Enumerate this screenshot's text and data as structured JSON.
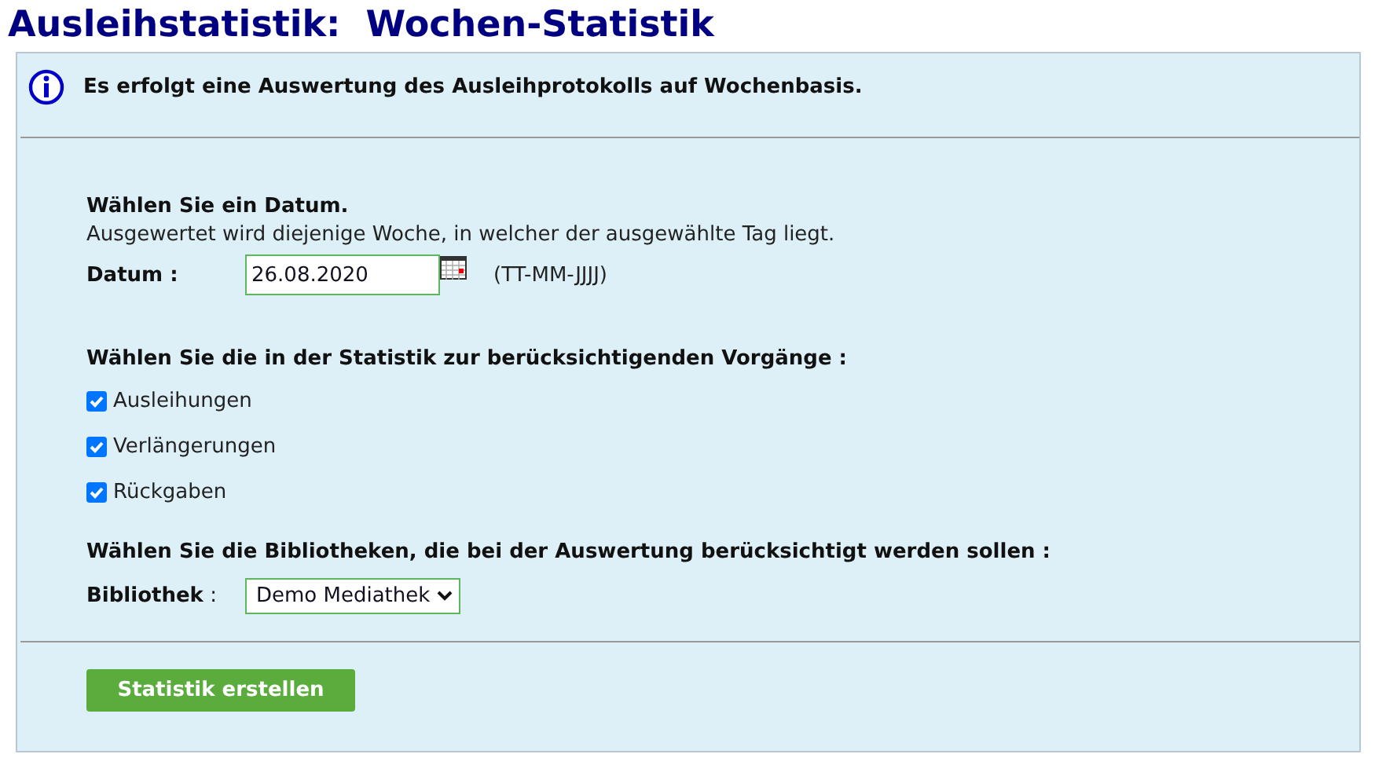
{
  "title": "Ausleihstatistik:  Wochen-Statistik",
  "info": "Es erfolgt eine Auswertung des Ausleihprotokolls auf Wochenbasis.",
  "date_section": {
    "heading": "Wählen Sie ein Datum.",
    "hint": "Ausgewertet wird diejenige Woche, in welcher der ausgewählte Tag liegt.",
    "label": "Datum :",
    "value": "26.08.2020",
    "format": "(TT-MM-JJJJ)"
  },
  "types_section": {
    "heading": "Wählen Sie die in der Statistik zur berücksichtigenden Vorgänge :",
    "options": [
      {
        "label": "Ausleihungen",
        "checked": true
      },
      {
        "label": "Verlängerungen",
        "checked": true
      },
      {
        "label": "Rückgaben",
        "checked": true
      }
    ]
  },
  "library_section": {
    "heading": "Wählen Sie die Bibliotheken, die bei der Auswertung berücksichtigt werden sollen :",
    "label": "**Bibliothek** :",
    "value": "Demo Mediathek"
  },
  "submit_button": "Statistik erstellen"
}
